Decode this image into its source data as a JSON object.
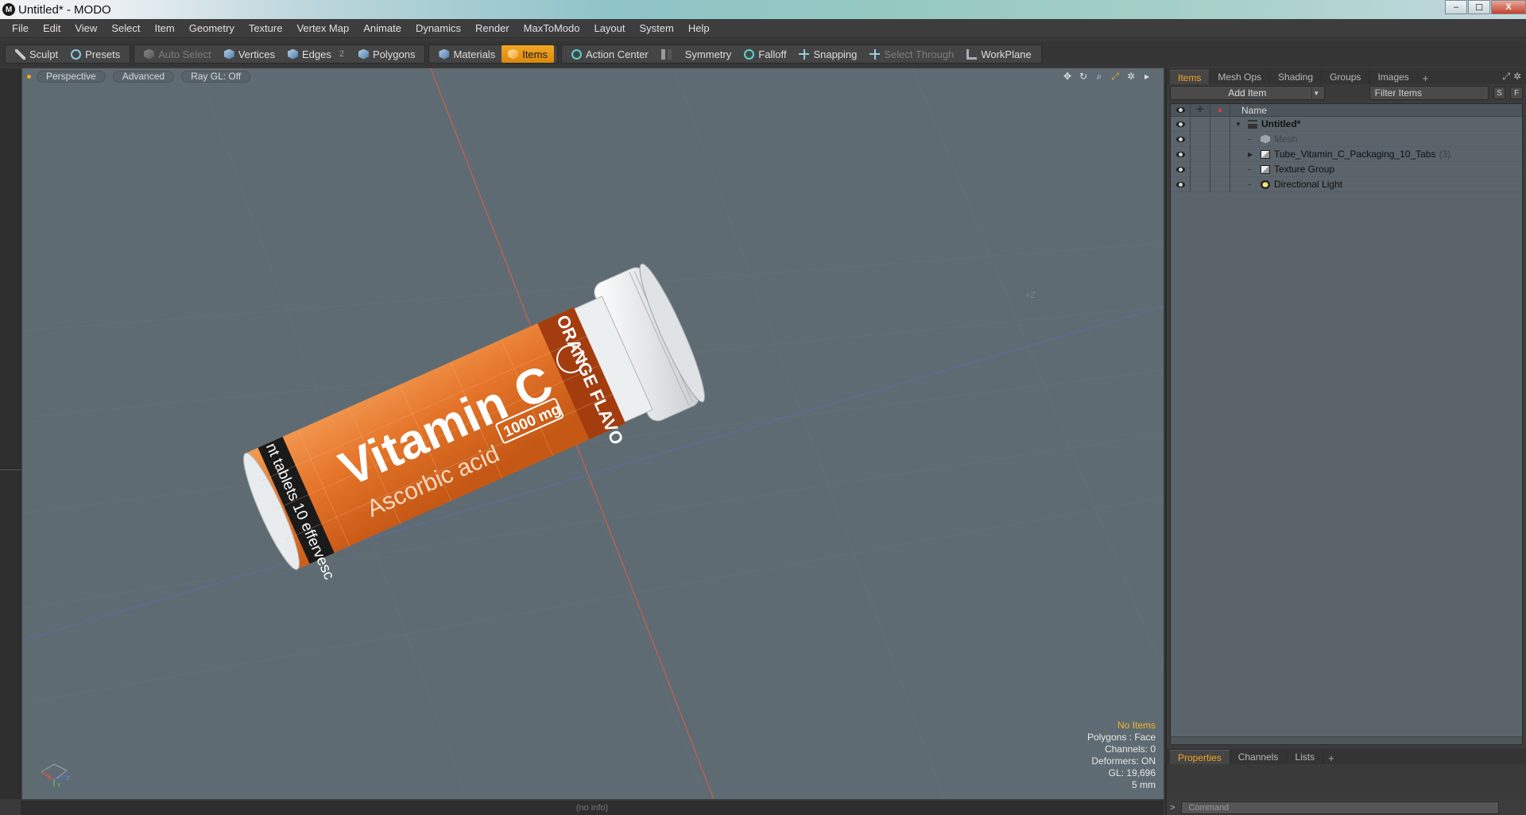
{
  "window": {
    "title": "Untitled* - MODO",
    "app_icon": "modo-icon",
    "controls": {
      "minimize": "–",
      "maximize": "☐",
      "close": "X"
    }
  },
  "menubar": {
    "items": [
      "File",
      "Edit",
      "View",
      "Select",
      "Item",
      "Geometry",
      "Texture",
      "Vertex Map",
      "Animate",
      "Dynamics",
      "Render",
      "MaxToModo",
      "Layout",
      "System",
      "Help"
    ]
  },
  "toolbar": {
    "sculpt": "Sculpt",
    "presets": "Presets",
    "auto_select": "Auto Select",
    "vertices": "Vertices",
    "edges": "Edges",
    "edges_count": "2",
    "polygons": "Polygons",
    "materials": "Materials",
    "items": "Items",
    "action_center": "Action Center",
    "symmetry": "Symmetry",
    "falloff": "Falloff",
    "snapping": "Snapping",
    "select_through": "Select Through",
    "workplane": "WorkPlane"
  },
  "viewport": {
    "view_mode": "Perspective",
    "shading": "Advanced",
    "ray_gl": "Ray GL: Off",
    "axis_z_label": "+Z",
    "stats": {
      "selection": "No Items",
      "polygons": "Polygons : Face",
      "channels": "Channels: 0",
      "deformers": "Deformers: ON",
      "gl": "GL: 19,696",
      "unit": "5 mm"
    },
    "model_label": {
      "brand": "Vitamin C",
      "sub": "Ascorbic acid",
      "dose": "1000 mg",
      "side_band": "ORANGE FLAVO",
      "side_band_prefix": "H",
      "bottom_band": "nt tablets 10 effervesc"
    },
    "gizmo": {
      "x": "X",
      "y": "Y",
      "z": "Z"
    }
  },
  "statusbar": {
    "info": "(no info)"
  },
  "items_panel": {
    "tabs": [
      "Items",
      "Mesh Ops",
      "Shading",
      "Groups",
      "Images"
    ],
    "active_tab": "Items",
    "add_item": "Add Item",
    "filter_placeholder": "Filter Items",
    "btn_s": "S",
    "btn_f": "F",
    "name_header": "Name",
    "rows": [
      {
        "label": "Untitled*",
        "count": ""
      },
      {
        "label": "Mesh",
        "count": ""
      },
      {
        "label": "Tube_Vitamin_C_Packaging_10_Tabs",
        "count": "(3)"
      },
      {
        "label": "Texture Group",
        "count": ""
      },
      {
        "label": "Directional Light",
        "count": ""
      }
    ]
  },
  "properties_panel": {
    "tabs": [
      "Properties",
      "Channels",
      "Lists"
    ],
    "active_tab": "Properties"
  },
  "command": {
    "prompt": ">",
    "placeholder": "Command"
  }
}
